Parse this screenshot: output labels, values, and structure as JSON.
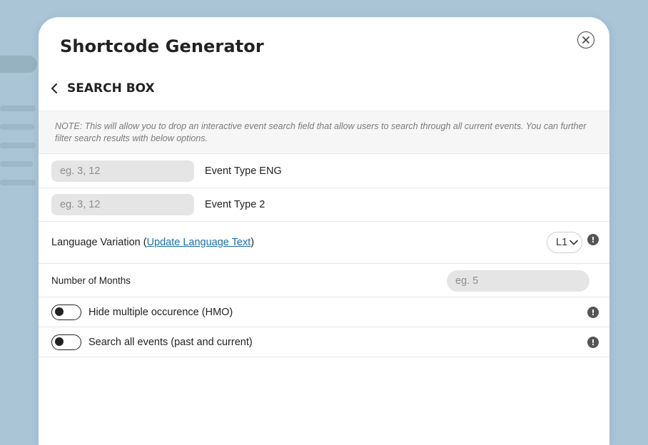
{
  "modal": {
    "title": "Shortcode Generator",
    "section_title": "SEARCH BOX",
    "note": "NOTE: This will allow you to drop an interactive event search field that allow users to search through all current events. You can further filter search results with below options."
  },
  "fields": {
    "event_type_eng": {
      "placeholder": "eg. 3, 12",
      "value": "",
      "label": "Event Type ENG"
    },
    "event_type_2": {
      "placeholder": "eg. 3, 12",
      "value": "",
      "label": "Event Type 2"
    },
    "language": {
      "label_prefix": "Language Variation (",
      "link_text": "Update Language Text",
      "label_suffix": ")",
      "selected": "L1"
    },
    "months": {
      "label": "Number of Months",
      "placeholder": "eg. 5",
      "value": ""
    },
    "hide_multiple": {
      "label": "Hide multiple occurence (HMO)",
      "enabled": false
    },
    "search_all": {
      "label": "Search all events (past and current)",
      "enabled": false
    }
  },
  "icons": {
    "close": "close-icon",
    "back": "chevron-left-icon",
    "info": "info-icon",
    "dropdown": "chevron-down-icon",
    "info_glyph": "!"
  }
}
